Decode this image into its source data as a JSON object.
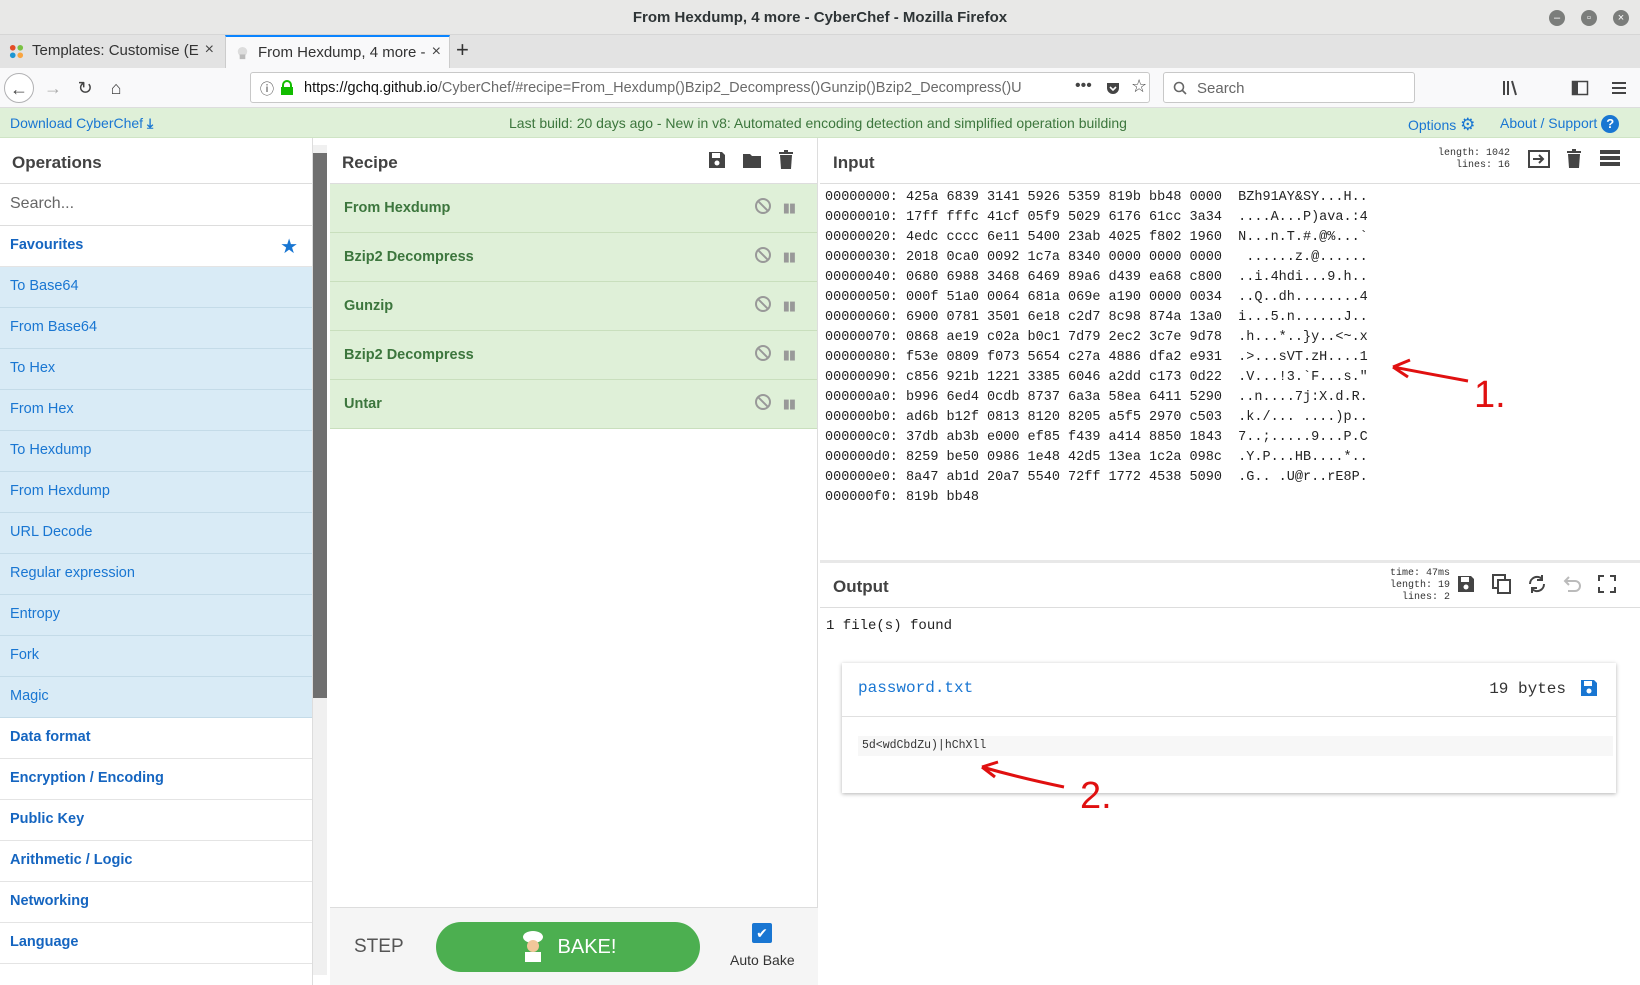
{
  "window": {
    "title": "From Hexdump, 4 more - CyberChef - Mozilla Firefox"
  },
  "tabs": [
    {
      "label": "Templates: Customise (E",
      "active": false
    },
    {
      "label": "From Hexdump, 4 more -",
      "active": true
    }
  ],
  "nav": {
    "url_host": "https://gchq.github.io",
    "url_path": "/CyberChef/#recipe=From_Hexdump()Bzip2_Decompress()Gunzip()Bzip2_Decompress()U",
    "search_placeholder": "Search"
  },
  "banner": {
    "download": "Download CyberChef",
    "message": "Last build: 20 days ago - New in v8: Automated encoding detection and simplified operation building",
    "options": "Options",
    "about": "About / Support"
  },
  "operations": {
    "title": "Operations",
    "search_placeholder": "Search...",
    "favourites": "Favourites",
    "favourite_items": [
      "To Base64",
      "From Base64",
      "To Hex",
      "From Hex",
      "To Hexdump",
      "From Hexdump",
      "URL Decode",
      "Regular expression",
      "Entropy",
      "Fork",
      "Magic"
    ],
    "categories": [
      "Data format",
      "Encryption / Encoding",
      "Public Key",
      "Arithmetic / Logic",
      "Networking",
      "Language"
    ]
  },
  "recipe": {
    "title": "Recipe",
    "items": [
      "From Hexdump",
      "Bzip2 Decompress",
      "Gunzip",
      "Bzip2 Decompress",
      "Untar"
    ],
    "step": "STEP",
    "bake": "BAKE!",
    "auto_bake": "Auto Bake",
    "auto_bake_checked": true
  },
  "input": {
    "title": "Input",
    "stats": {
      "length": "length: 1042",
      "lines": "lines:   16"
    },
    "hex_lines": [
      "00000000: 425a 6839 3141 5926 5359 819b bb48 0000  BZh91AY&SY...H..",
      "00000010: 17ff fffc 41cf 05f9 5029 6176 61cc 3a34  ....A...P)ava.:4",
      "00000020: 4edc cccc 6e11 5400 23ab 4025 f802 1960  N...n.T.#.@%...`",
      "00000030: 2018 0ca0 0092 1c7a 8340 0000 0000 0000   ......z.@......",
      "00000040: 0680 6988 3468 6469 89a6 d439 ea68 c800  ..i.4hdi...9.h..",
      "00000050: 000f 51a0 0064 681a 069e a190 0000 0034  ..Q..dh........4",
      "00000060: 6900 0781 3501 6e18 c2d7 8c98 874a 13a0  i...5.n......J..",
      "00000070: 0868 ae19 c02a b0c1 7d79 2ec2 3c7e 9d78  .h...*..}y..<~.x",
      "00000080: f53e 0809 f073 5654 c27a 4886 dfa2 e931  .>...sVT.zH....1",
      "00000090: c856 921b 1221 3385 6046 a2dd c173 0d22  .V...!3.`F...s.\"",
      "000000a0: b996 6ed4 0cdb 8737 6a3a 58ea 6411 5290  ..n....7j:X.d.R.",
      "000000b0: ad6b b12f 0813 8120 8205 a5f5 2970 c503  .k./... ....)p..",
      "000000c0: 37db ab3b e000 ef85 f439 a414 8850 1843  7..;.....9...P.C",
      "000000d0: 8259 be50 0986 1e48 42d5 13ea 1c2a 098c  .Y.P...HB....*..",
      "000000e0: 8a47 ab1d 20a7 5540 72ff 1772 4538 5090  .G.. .U@r..rE8P.",
      "000000f0: 819b bb48"
    ]
  },
  "output": {
    "title": "Output",
    "stats": {
      "time": "time: 47ms",
      "length": "length:   19",
      "lines": "lines:    2"
    },
    "summary": "1 file(s) found",
    "file": {
      "name": "password.txt",
      "size": "19 bytes",
      "content": "5d<wdCbdZu)|hChXll"
    }
  },
  "annotations": {
    "label_1": "1.",
    "label_2": "2."
  },
  "colors": {
    "accent": "#1976d2",
    "bake": "#4caf50",
    "recipe_bg": "#dff0d8",
    "banner_bg": "#dff0d8",
    "fav_bg": "#d9ebf6",
    "annotation": "#e01010"
  }
}
